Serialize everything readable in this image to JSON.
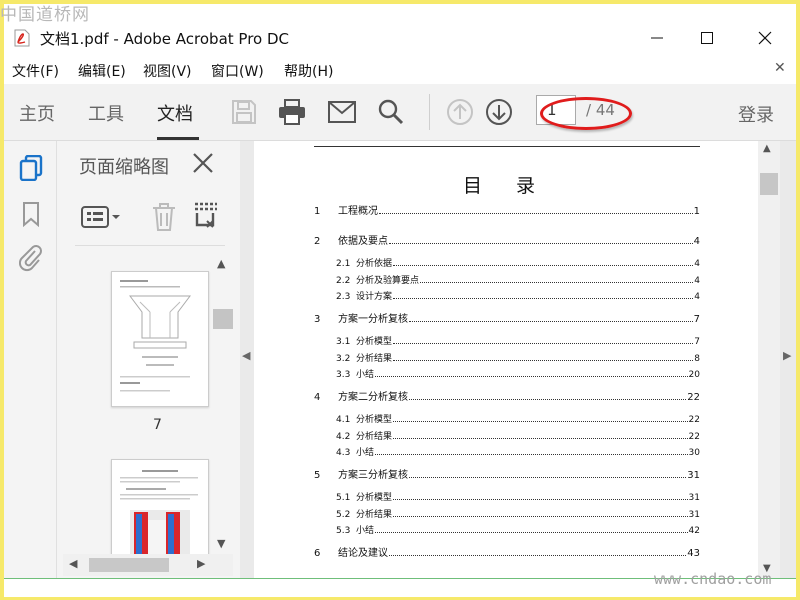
{
  "watermark": {
    "top": "中国道桥网",
    "bottom": "www.cndao.com"
  },
  "window": {
    "title": "文档1.pdf - Adobe Acrobat Pro DC"
  },
  "menu": [
    "文件(F)",
    "编辑(E)",
    "视图(V)",
    "窗口(W)",
    "帮助(H)"
  ],
  "toolbar": {
    "tabs": [
      {
        "label": "主页",
        "active": false
      },
      {
        "label": "工具",
        "active": false
      },
      {
        "label": "文档",
        "active": true
      }
    ],
    "icons": [
      "save-icon",
      "print-icon",
      "email-icon",
      "search-icon",
      "page-up-icon",
      "page-down-icon"
    ],
    "page_current": "1",
    "page_total": "/ 44",
    "login": "登录"
  },
  "panel": {
    "title": "页面缩略图",
    "thumbnails": [
      {
        "label": "7"
      }
    ]
  },
  "document": {
    "title": "目  录",
    "toc": [
      {
        "num": "1",
        "title": "工程概况",
        "page": "1",
        "level": 1
      },
      {
        "num": "2",
        "title": "依据及要点",
        "page": "4",
        "level": 1
      },
      {
        "num": "2.1",
        "title": "分析依据",
        "page": "4",
        "level": 2
      },
      {
        "num": "2.2",
        "title": "分析及验算要点",
        "page": "4",
        "level": 2
      },
      {
        "num": "2.3",
        "title": "设计方案",
        "page": "4",
        "level": 2
      },
      {
        "num": "3",
        "title": "方案一分析复核",
        "page": "7",
        "level": 1
      },
      {
        "num": "3.1",
        "title": "分析模型",
        "page": "7",
        "level": 2
      },
      {
        "num": "3.2",
        "title": "分析结果",
        "page": "8",
        "level": 2
      },
      {
        "num": "3.3",
        "title": "小结",
        "page": "20",
        "level": 2
      },
      {
        "num": "4",
        "title": "方案二分析复核",
        "page": "22",
        "level": 1
      },
      {
        "num": "4.1",
        "title": "分析模型",
        "page": "22",
        "level": 2
      },
      {
        "num": "4.2",
        "title": "分析结果",
        "page": "22",
        "level": 2
      },
      {
        "num": "4.3",
        "title": "小结",
        "page": "30",
        "level": 2
      },
      {
        "num": "5",
        "title": "方案三分析复核",
        "page": "31",
        "level": 1
      },
      {
        "num": "5.1",
        "title": "分析模型",
        "page": "31",
        "level": 2
      },
      {
        "num": "5.2",
        "title": "分析结果",
        "page": "31",
        "level": 2
      },
      {
        "num": "5.3",
        "title": "小结",
        "page": "42",
        "level": 2
      },
      {
        "num": "6",
        "title": "结论及建议",
        "page": "43",
        "level": 1
      }
    ]
  },
  "colors": {
    "highlight_ellipse": "#e01c1c",
    "active_rail_icon": "#1a73c9",
    "pdf_icon": "#d7261e"
  }
}
